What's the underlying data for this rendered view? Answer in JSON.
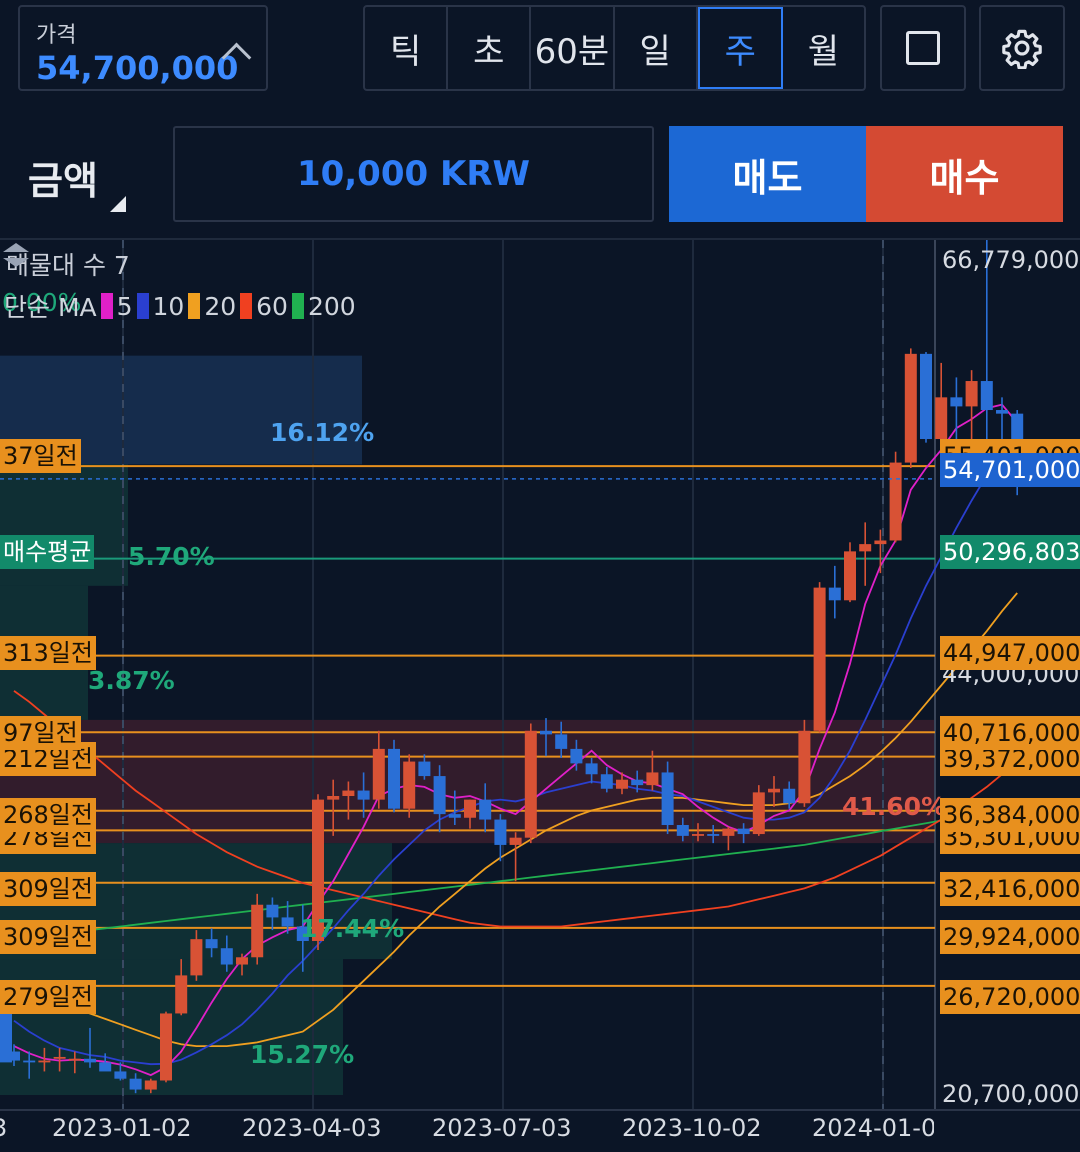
{
  "header": {
    "price_label": "가격",
    "price_value": "54,700,000",
    "timeframes": [
      "틱",
      "초",
      "60분",
      "일",
      "주",
      "월"
    ],
    "active_timeframe": "주"
  },
  "order": {
    "amount_label": "금액",
    "amount_value": "10,000 KRW",
    "sell_label": "매도",
    "buy_label": "매수"
  },
  "colors": {
    "up": "#d85235",
    "down": "#2a6fd6",
    "accent": "#2f7df6",
    "ma5": "#e020c8",
    "ma10": "#2a3fd0",
    "ma20": "#f0a020",
    "ma60": "#f04020",
    "ma200": "#20b050"
  },
  "chart": {
    "volume_profile_title": "매물대 수 7",
    "ma_prefix": "단순 MA",
    "ma_periods": [
      "5",
      "10",
      "20",
      "60",
      "200"
    ],
    "ghost_text": "0.00%",
    "y_axis_labels": [
      "66,779,000",
      "44,000,000",
      "39,372,000",
      "35,301,000",
      "20,700,000"
    ],
    "x_axis_labels": [
      "3",
      "2023-01-02",
      "2023-04-03",
      "2023-07-03",
      "2023-10-02",
      "2024-01-0"
    ],
    "current_price": "54,701,000",
    "hidden_price": "55,401,000",
    "avg_buy": {
      "label": "매수평균",
      "price": "50,296,803",
      "pct": "5.70%"
    },
    "levels": [
      {
        "label": "37일전",
        "price": ""
      },
      {
        "label": "313일전",
        "price": "44,947,000"
      },
      {
        "label": "97일전",
        "price": "40,716,000"
      },
      {
        "label": "212일전",
        "price": ""
      },
      {
        "label": "268일전",
        "price": "36,384,000"
      },
      {
        "label": "278일전",
        "price": ""
      },
      {
        "label": "309일전",
        "price": "32,416,000"
      },
      {
        "label": "309일전",
        "price": "29,924,000"
      },
      {
        "label": "279일전",
        "price": "26,720,000"
      }
    ],
    "zone_pcts": [
      "16.12%",
      "3.87%",
      "17.44%",
      "15.27%",
      "41.60%"
    ]
  },
  "chart_data": {
    "type": "candlestick",
    "y_range": [
      20700000,
      66779000
    ],
    "candles": [
      {
        "o": 23100000,
        "h": 23500000,
        "l": 22300000,
        "c": 22600000
      },
      {
        "o": 22600000,
        "h": 23100000,
        "l": 21600000,
        "c": 22500000
      },
      {
        "o": 22500000,
        "h": 23300000,
        "l": 22000000,
        "c": 22600000
      },
      {
        "o": 22700000,
        "h": 23300000,
        "l": 22000000,
        "c": 22800000
      },
      {
        "o": 22600000,
        "h": 23100000,
        "l": 21900000,
        "c": 22700000
      },
      {
        "o": 22700000,
        "h": 24400000,
        "l": 22200000,
        "c": 22500000
      },
      {
        "o": 22500000,
        "h": 23000000,
        "l": 22100000,
        "c": 22000000
      },
      {
        "o": 22000000,
        "h": 22500000,
        "l": 21500000,
        "c": 21600000
      },
      {
        "o": 21600000,
        "h": 21900000,
        "l": 20800000,
        "c": 21000000
      },
      {
        "o": 21000000,
        "h": 21600000,
        "l": 20800000,
        "c": 21500000
      },
      {
        "o": 21500000,
        "h": 25300000,
        "l": 21400000,
        "c": 25200000
      },
      {
        "o": 25200000,
        "h": 28200000,
        "l": 25100000,
        "c": 27300000
      },
      {
        "o": 27300000,
        "h": 29800000,
        "l": 27000000,
        "c": 29300000
      },
      {
        "o": 29300000,
        "h": 29900000,
        "l": 28300000,
        "c": 28800000
      },
      {
        "o": 28800000,
        "h": 29500000,
        "l": 27500000,
        "c": 27900000
      },
      {
        "o": 27900000,
        "h": 28500000,
        "l": 27300000,
        "c": 28300000
      },
      {
        "o": 28300000,
        "h": 31800000,
        "l": 27900000,
        "c": 31200000
      },
      {
        "o": 31200000,
        "h": 31600000,
        "l": 29800000,
        "c": 30500000
      },
      {
        "o": 30500000,
        "h": 31400000,
        "l": 29600000,
        "c": 30000000
      },
      {
        "o": 30000000,
        "h": 31200000,
        "l": 27500000,
        "c": 29200000
      },
      {
        "o": 29200000,
        "h": 37300000,
        "l": 28700000,
        "c": 37000000
      },
      {
        "o": 37000000,
        "h": 38100000,
        "l": 35000000,
        "c": 37200000
      },
      {
        "o": 37200000,
        "h": 38000000,
        "l": 35900000,
        "c": 37500000
      },
      {
        "o": 37500000,
        "h": 38500000,
        "l": 36000000,
        "c": 37000000
      },
      {
        "o": 37000000,
        "h": 40800000,
        "l": 36500000,
        "c": 39800000
      },
      {
        "o": 39800000,
        "h": 40300000,
        "l": 36300000,
        "c": 36500000
      },
      {
        "o": 36500000,
        "h": 39500000,
        "l": 36000000,
        "c": 39100000
      },
      {
        "o": 39100000,
        "h": 39500000,
        "l": 38100000,
        "c": 38300000
      },
      {
        "o": 38300000,
        "h": 38900000,
        "l": 35200000,
        "c": 36200000
      },
      {
        "o": 36200000,
        "h": 37500000,
        "l": 35600000,
        "c": 36000000
      },
      {
        "o": 36000000,
        "h": 37000000,
        "l": 35400000,
        "c": 37000000
      },
      {
        "o": 37000000,
        "h": 37900000,
        "l": 35200000,
        "c": 35900000
      },
      {
        "o": 35900000,
        "h": 36200000,
        "l": 33600000,
        "c": 34500000
      },
      {
        "o": 34500000,
        "h": 35200000,
        "l": 32500000,
        "c": 34900000
      },
      {
        "o": 34900000,
        "h": 41200000,
        "l": 34600000,
        "c": 40800000
      },
      {
        "o": 40800000,
        "h": 41500000,
        "l": 39400000,
        "c": 40600000
      },
      {
        "o": 40600000,
        "h": 41300000,
        "l": 39300000,
        "c": 39800000
      },
      {
        "o": 39800000,
        "h": 40300000,
        "l": 38600000,
        "c": 39000000
      },
      {
        "o": 39000000,
        "h": 39300000,
        "l": 37900000,
        "c": 38400000
      },
      {
        "o": 38400000,
        "h": 38800000,
        "l": 37400000,
        "c": 37600000
      },
      {
        "o": 37600000,
        "h": 38500000,
        "l": 37300000,
        "c": 38100000
      },
      {
        "o": 38100000,
        "h": 38600000,
        "l": 37400000,
        "c": 37800000
      },
      {
        "o": 37800000,
        "h": 39700000,
        "l": 37500000,
        "c": 38500000
      },
      {
        "o": 38500000,
        "h": 39100000,
        "l": 35100000,
        "c": 35600000
      },
      {
        "o": 35600000,
        "h": 36000000,
        "l": 34700000,
        "c": 35000000
      },
      {
        "o": 35000000,
        "h": 35700000,
        "l": 34700000,
        "c": 35100000
      },
      {
        "o": 35100000,
        "h": 35600000,
        "l": 34600000,
        "c": 35000000
      },
      {
        "o": 35000000,
        "h": 35500000,
        "l": 34200000,
        "c": 35400000
      },
      {
        "o": 35400000,
        "h": 35700000,
        "l": 34600000,
        "c": 35100000
      },
      {
        "o": 35100000,
        "h": 37800000,
        "l": 35000000,
        "c": 37400000
      },
      {
        "o": 37400000,
        "h": 38300000,
        "l": 36600000,
        "c": 37600000
      },
      {
        "o": 37600000,
        "h": 38000000,
        "l": 36500000,
        "c": 36800000
      },
      {
        "o": 36800000,
        "h": 41400000,
        "l": 36600000,
        "c": 40800000
      },
      {
        "o": 40800000,
        "h": 49000000,
        "l": 40700000,
        "c": 48700000
      },
      {
        "o": 48700000,
        "h": 49900000,
        "l": 47000000,
        "c": 48000000
      },
      {
        "o": 48000000,
        "h": 51200000,
        "l": 47900000,
        "c": 50700000
      },
      {
        "o": 50700000,
        "h": 52300000,
        "l": 48800000,
        "c": 51100000
      },
      {
        "o": 51100000,
        "h": 51900000,
        "l": 49500000,
        "c": 51300000
      },
      {
        "o": 51300000,
        "h": 56200000,
        "l": 51200000,
        "c": 55600000
      },
      {
        "o": 55600000,
        "h": 61900000,
        "l": 55300000,
        "c": 61600000
      },
      {
        "o": 61600000,
        "h": 61700000,
        "l": 56700000,
        "c": 56900000
      },
      {
        "o": 56900000,
        "h": 61100000,
        "l": 56400000,
        "c": 59200000
      },
      {
        "o": 59200000,
        "h": 60300000,
        "l": 55500000,
        "c": 58700000
      },
      {
        "o": 58700000,
        "h": 60700000,
        "l": 54800000,
        "c": 60100000
      },
      {
        "o": 60100000,
        "h": 69000000,
        "l": 56800000,
        "c": 58500000
      },
      {
        "o": 58500000,
        "h": 59200000,
        "l": 56300000,
        "c": 58300000
      },
      {
        "o": 58300000,
        "h": 58500000,
        "l": 53800000,
        "c": 54701000
      }
    ],
    "ma5": [
      23400000,
      23000000,
      22700000,
      22600000,
      22650000,
      22620000,
      22540000,
      22380000,
      22120000,
      21800000,
      22240000,
      23100000,
      24400000,
      25800000,
      27100000,
      28200000,
      28950000,
      29400000,
      29800000,
      30000000,
      31300000,
      32500000,
      34000000,
      35500000,
      37200000,
      37600000,
      37800000,
      37700000,
      37300000,
      37100000,
      37200000,
      36900000,
      36500000,
      36200000,
      36900000,
      37600000,
      38300000,
      39000000,
      39700000,
      38900000,
      38400000,
      38000000,
      37900000,
      37600000,
      37300000,
      36600000,
      36000000,
      35500000,
      35200000,
      35600000,
      36100000,
      36400000,
      37500000,
      39800000,
      41800000,
      44500000,
      47800000,
      49900000,
      51300000,
      54100000,
      55300000,
      56300000,
      57500000,
      58000000,
      58600000,
      58800000,
      57800000
    ],
    "ma10": [
      24800000,
      24200000,
      23700000,
      23300000,
      23100000,
      22900000,
      22800000,
      22600000,
      22500000,
      22400000,
      22420000,
      22650000,
      23050000,
      23500000,
      24000000,
      24600000,
      25400000,
      26300000,
      27300000,
      28100000,
      29000000,
      29900000,
      30900000,
      31800000,
      32800000,
      33700000,
      34500000,
      35300000,
      35900000,
      36300000,
      36600000,
      36900000,
      37000000,
      36900000,
      37100000,
      37400000,
      37600000,
      37800000,
      38000000,
      37900000,
      37800000,
      37600000,
      37500000,
      37300000,
      37200000,
      36900000,
      36600000,
      36300000,
      36000000,
      35900000,
      35900000,
      36000000,
      36300000,
      37100000,
      38300000,
      39700000,
      41400000,
      43200000,
      45000000,
      47000000,
      48800000,
      50400000,
      52000000,
      53500000,
      54900000,
      56000000,
      56400000
    ],
    "ma20": [
      26700000,
      26400000,
      26100000,
      25800000,
      25500000,
      25200000,
      24900000,
      24600000,
      24300000,
      24000000,
      23700000,
      23500000,
      23400000,
      23400000,
      23400000,
      23500000,
      23600000,
      23800000,
      24000000,
      24200000,
      24800000,
      25400000,
      26200000,
      27000000,
      27800000,
      28600000,
      29500000,
      30300000,
      31100000,
      31800000,
      32500000,
      33200000,
      33800000,
      34300000,
      34800000,
      35300000,
      35700000,
      36100000,
      36400000,
      36600000,
      36800000,
      37000000,
      37100000,
      37100000,
      37100000,
      37000000,
      36900000,
      36800000,
      36700000,
      36700000,
      36700000,
      36800000,
      37000000,
      37300000,
      37800000,
      38300000,
      38900000,
      39600000,
      40400000,
      41300000,
      42300000,
      43300000,
      44300000,
      45300000,
      46300000,
      47400000,
      48400000
    ],
    "ma60": [
      43000000,
      42400000,
      41700000,
      41000000,
      40300000,
      39600000,
      38900000,
      38200000,
      37500000,
      36900000,
      36300000,
      35700000,
      35100000,
      34600000,
      34100000,
      33700000,
      33300000,
      33000000,
      32700000,
      32400000,
      32200000,
      32000000,
      31800000,
      31600000,
      31400000,
      31200000,
      31000000,
      30800000,
      30600000,
      30400000,
      30200000,
      30100000,
      30000000,
      30000000,
      30000000,
      30000000,
      30000000,
      30100000,
      30200000,
      30300000,
      30400000,
      30500000,
      30600000,
      30700000,
      30800000,
      30900000,
      31000000,
      31100000,
      31300000,
      31500000,
      31700000,
      31900000,
      32100000,
      32400000,
      32700000,
      33100000,
      33500000,
      33900000,
      34400000,
      34900000,
      35400000,
      35900000,
      36500000,
      37100000,
      37700000,
      38400000,
      39100000
    ],
    "ma200": [
      29300000,
      29400000,
      29500000,
      29600000,
      29700000,
      29800000,
      29900000,
      30000000,
      30100000,
      30200000,
      30300000,
      30400000,
      30500000,
      30600000,
      30700000,
      30800000,
      30900000,
      31000000,
      31100000,
      31200000,
      31300000,
      31400000,
      31500000,
      31600000,
      31700000,
      31800000,
      31900000,
      32000000,
      32100000,
      32200000,
      32300000,
      32400000,
      32500000,
      32600000,
      32700000,
      32800000,
      32900000,
      33000000,
      33100000,
      33200000,
      33300000,
      33400000,
      33500000,
      33600000,
      33700000,
      33800000,
      33900000,
      34000000,
      34100000,
      34200000,
      34300000,
      34400000,
      34500000,
      34650000,
      34800000,
      34950000,
      35100000,
      35250000,
      35400000,
      35550000,
      35700000,
      35850000,
      36000000,
      36150000,
      36300000,
      36450000,
      36600000
    ]
  }
}
